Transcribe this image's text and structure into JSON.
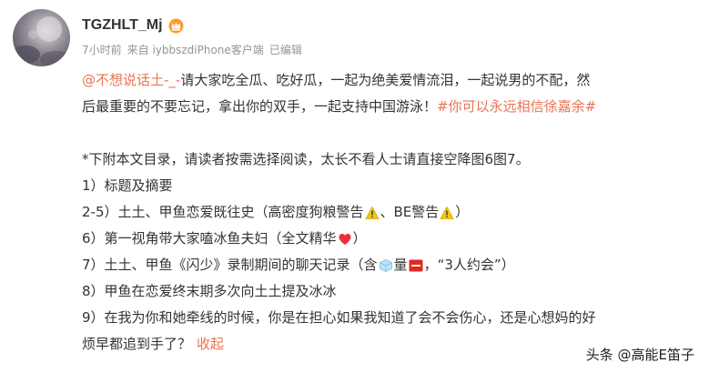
{
  "post": {
    "username": "TGZHLT_Mj",
    "badge_icon": "crown-vip-icon",
    "meta": {
      "time": "7小时前",
      "source": "来自 iybbszdiPhone客户端",
      "edited": "已编辑"
    },
    "content": {
      "l1": {
        "mention": "@不想说话土-_-",
        "text": " 请大家吃全瓜、吃好瓜，一起为绝美爱情流泪，一起说男的不配，然"
      },
      "l2": {
        "text": "后最重要的不要忘记，拿出你的双手，一起支持中国游泳！",
        "hashtag": "#你可以永远相信徐嘉余#"
      },
      "l3": "*下附本文目录，请读者按需选择阅读，太长不看人士请直接空降图6图7。",
      "l4": "1）标题及摘要",
      "l5": {
        "text": "2-5）土土、甲鱼恋爱既往史（高密度狗粮警告",
        "mid": "、BE警告",
        "end": "）"
      },
      "l6": {
        "text": "6）第一视角带大家嗑冰鱼夫妇（全文精华",
        "end": "）"
      },
      "l7": {
        "text": "7）土土、甲鱼《闪少》录制期间的聊天记录（含",
        "mid": "量",
        "end": "，“3人约会”）"
      },
      "l8": "8）甲鱼在恋爱终末期多次向土土提及冰冰",
      "l9": "9）在我为你和她牵线的时候，你是在担心如果我知道了会不会伤心，还是心想妈的好",
      "l10": {
        "text": "烦早都追到手了？",
        "collapse": "收起"
      }
    }
  },
  "watermark": "头条 @高能E笛子",
  "colors": {
    "link": "#eb7350",
    "text": "#333333",
    "meta": "#939393",
    "warning": "#f5c518",
    "heart": "#e8313a",
    "sos": "#e02a20"
  }
}
